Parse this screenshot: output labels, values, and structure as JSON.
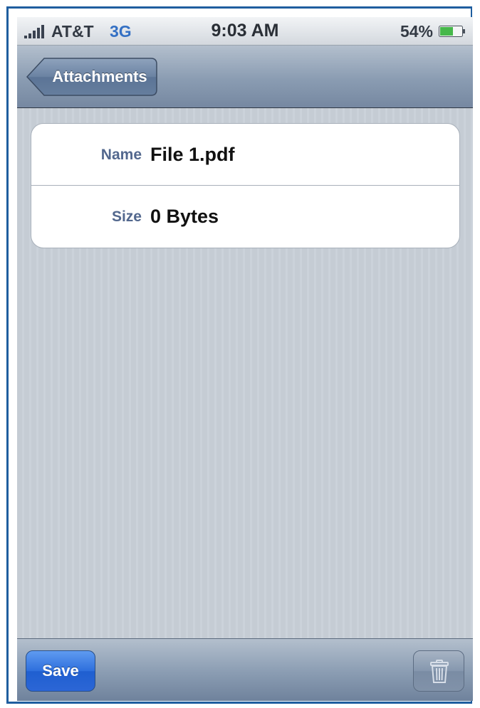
{
  "status_bar": {
    "carrier": "AT&T",
    "network": "3G",
    "time": "9:03 AM",
    "battery_percent": "54%",
    "network_color": "#3470c4"
  },
  "nav_bar": {
    "back_label": "Attachments"
  },
  "details": {
    "rows": [
      {
        "label": "Name",
        "value": "File 1.pdf"
      },
      {
        "label": "Size",
        "value": "0 Bytes"
      }
    ]
  },
  "toolbar": {
    "save_label": "Save",
    "trash_icon": "trash-icon",
    "save_color": "#2e6fdd"
  }
}
